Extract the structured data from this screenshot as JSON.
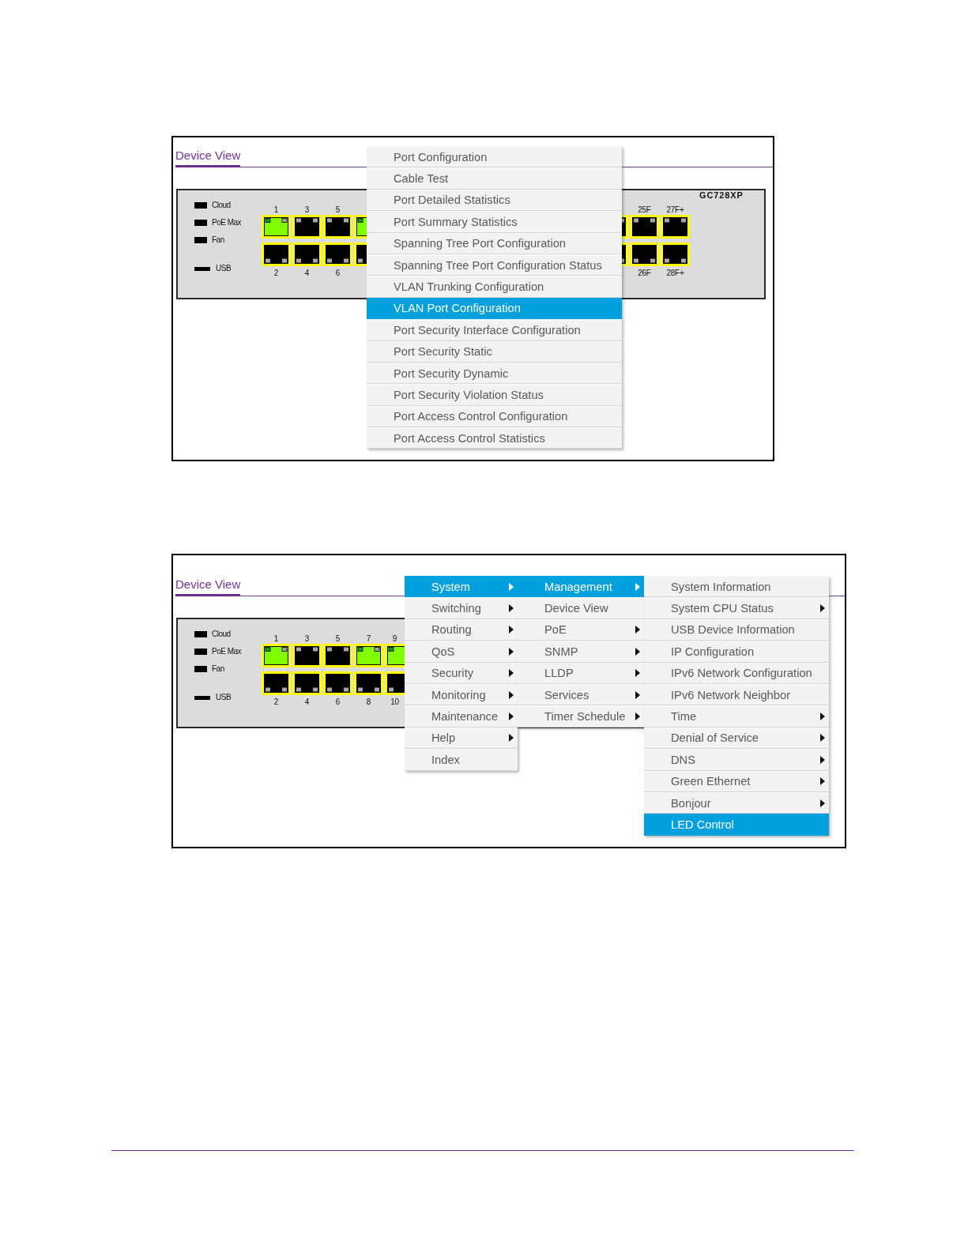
{
  "figures": [
    {
      "title": "Device View",
      "leds": [
        {
          "label": "Cloud",
          "kind": "led"
        },
        {
          "label": "PoE Max",
          "kind": "led"
        },
        {
          "label": "Fan",
          "kind": "led"
        },
        {
          "label": "USB",
          "kind": "usb"
        }
      ],
      "ports_left": [
        {
          "top": {
            "number": "1",
            "link": true
          },
          "bottom": {
            "number": "2",
            "link": false
          }
        },
        {
          "top": {
            "number": "3",
            "link": false
          },
          "bottom": {
            "number": "4",
            "link": false
          }
        },
        {
          "top": {
            "number": "5",
            "link": false
          },
          "bottom": {
            "number": "6",
            "link": false
          }
        },
        {
          "top": {
            "link": true
          },
          "bottom": {
            "link": false
          }
        }
      ],
      "ports_right": [
        {
          "top": {
            "link": false
          },
          "bottom": {
            "link": false
          }
        },
        {
          "top": {
            "number": "25F",
            "link": false
          },
          "bottom": {
            "number": "26F",
            "link": false
          }
        },
        {
          "top": {
            "number": "27F+",
            "link": false
          },
          "bottom": {
            "number": "28F+",
            "link": false
          }
        }
      ],
      "model": "GC728XP",
      "menus": [
        {
          "items": [
            {
              "label": "Port Configuration",
              "selected": false
            },
            {
              "label": "Cable Test",
              "selected": false
            },
            {
              "label": "Port Detailed Statistics",
              "selected": false
            },
            {
              "label": "Port Summary Statistics",
              "selected": false
            },
            {
              "label": "Spanning Tree Port Configuration",
              "selected": false
            },
            {
              "label": "Spanning Tree Port Configuration Status",
              "selected": false
            },
            {
              "label": "VLAN Trunking Configuration",
              "selected": false
            },
            {
              "label": "VLAN Port Configuration",
              "selected": true
            },
            {
              "label": "Port Security Interface Configuration",
              "selected": false
            },
            {
              "label": "Port Security Static",
              "selected": false
            },
            {
              "label": "Port Security Dynamic",
              "selected": false
            },
            {
              "label": "Port Security Violation Status",
              "selected": false
            },
            {
              "label": "Port Access Control Configuration",
              "selected": false
            },
            {
              "label": "Port Access Control Statistics",
              "selected": false
            }
          ]
        }
      ]
    },
    {
      "title": "Device View",
      "leds": [
        {
          "label": "Cloud",
          "kind": "led"
        },
        {
          "label": "PoE Max",
          "kind": "led"
        },
        {
          "label": "Fan",
          "kind": "led"
        },
        {
          "label": "USB",
          "kind": "usb"
        }
      ],
      "ports_left": [
        {
          "top": {
            "number": "1",
            "link": true
          },
          "bottom": {
            "number": "2",
            "link": false
          }
        },
        {
          "top": {
            "number": "3",
            "link": false
          },
          "bottom": {
            "number": "4",
            "link": false
          }
        },
        {
          "top": {
            "number": "5",
            "link": false
          },
          "bottom": {
            "number": "6",
            "link": false
          }
        },
        {
          "top": {
            "number": "7",
            "link": true
          },
          "bottom": {
            "number": "8",
            "link": false
          }
        },
        {
          "top": {
            "number": "9",
            "link": true
          },
          "bottom": {
            "number": "10",
            "link": false
          }
        }
      ],
      "menus": [
        {
          "items": [
            {
              "label": "System",
              "selected": true,
              "submenu": true
            },
            {
              "label": "Switching",
              "selected": false,
              "submenu": true
            },
            {
              "label": "Routing",
              "selected": false,
              "submenu": true
            },
            {
              "label": "QoS",
              "selected": false,
              "submenu": true
            },
            {
              "label": "Security",
              "selected": false,
              "submenu": true
            },
            {
              "label": "Monitoring",
              "selected": false,
              "submenu": true
            },
            {
              "label": "Maintenance",
              "selected": false,
              "submenu": true
            },
            {
              "label": "Help",
              "selected": false,
              "submenu": true
            },
            {
              "label": "Index",
              "selected": false,
              "submenu": false
            }
          ]
        },
        {
          "items": [
            {
              "label": "Management",
              "selected": true,
              "submenu": true
            },
            {
              "label": "Device View",
              "selected": false,
              "submenu": false
            },
            {
              "label": "PoE",
              "selected": false,
              "submenu": true
            },
            {
              "label": "SNMP",
              "selected": false,
              "submenu": true
            },
            {
              "label": "LLDP",
              "selected": false,
              "submenu": true
            },
            {
              "label": "Services",
              "selected": false,
              "submenu": true
            },
            {
              "label": "Timer Schedule",
              "selected": false,
              "submenu": true
            }
          ]
        },
        {
          "items": [
            {
              "label": "System Information",
              "selected": false,
              "submenu": false
            },
            {
              "label": "System CPU Status",
              "selected": false,
              "submenu": true
            },
            {
              "label": "USB Device Information",
              "selected": false,
              "submenu": false
            },
            {
              "label": "IP Configuration",
              "selected": false,
              "submenu": false
            },
            {
              "label": "IPv6 Network Configuration",
              "selected": false,
              "submenu": false
            },
            {
              "label": "IPv6 Network Neighbor",
              "selected": false,
              "submenu": false
            },
            {
              "label": "Time",
              "selected": false,
              "submenu": true
            },
            {
              "label": "Denial of Service",
              "selected": false,
              "submenu": true
            },
            {
              "label": "DNS",
              "selected": false,
              "submenu": true
            },
            {
              "label": "Green Ethernet",
              "selected": false,
              "submenu": true
            },
            {
              "label": "Bonjour",
              "selected": false,
              "submenu": true
            },
            {
              "label": "LED Control",
              "selected": true,
              "submenu": false
            }
          ]
        }
      ]
    }
  ]
}
